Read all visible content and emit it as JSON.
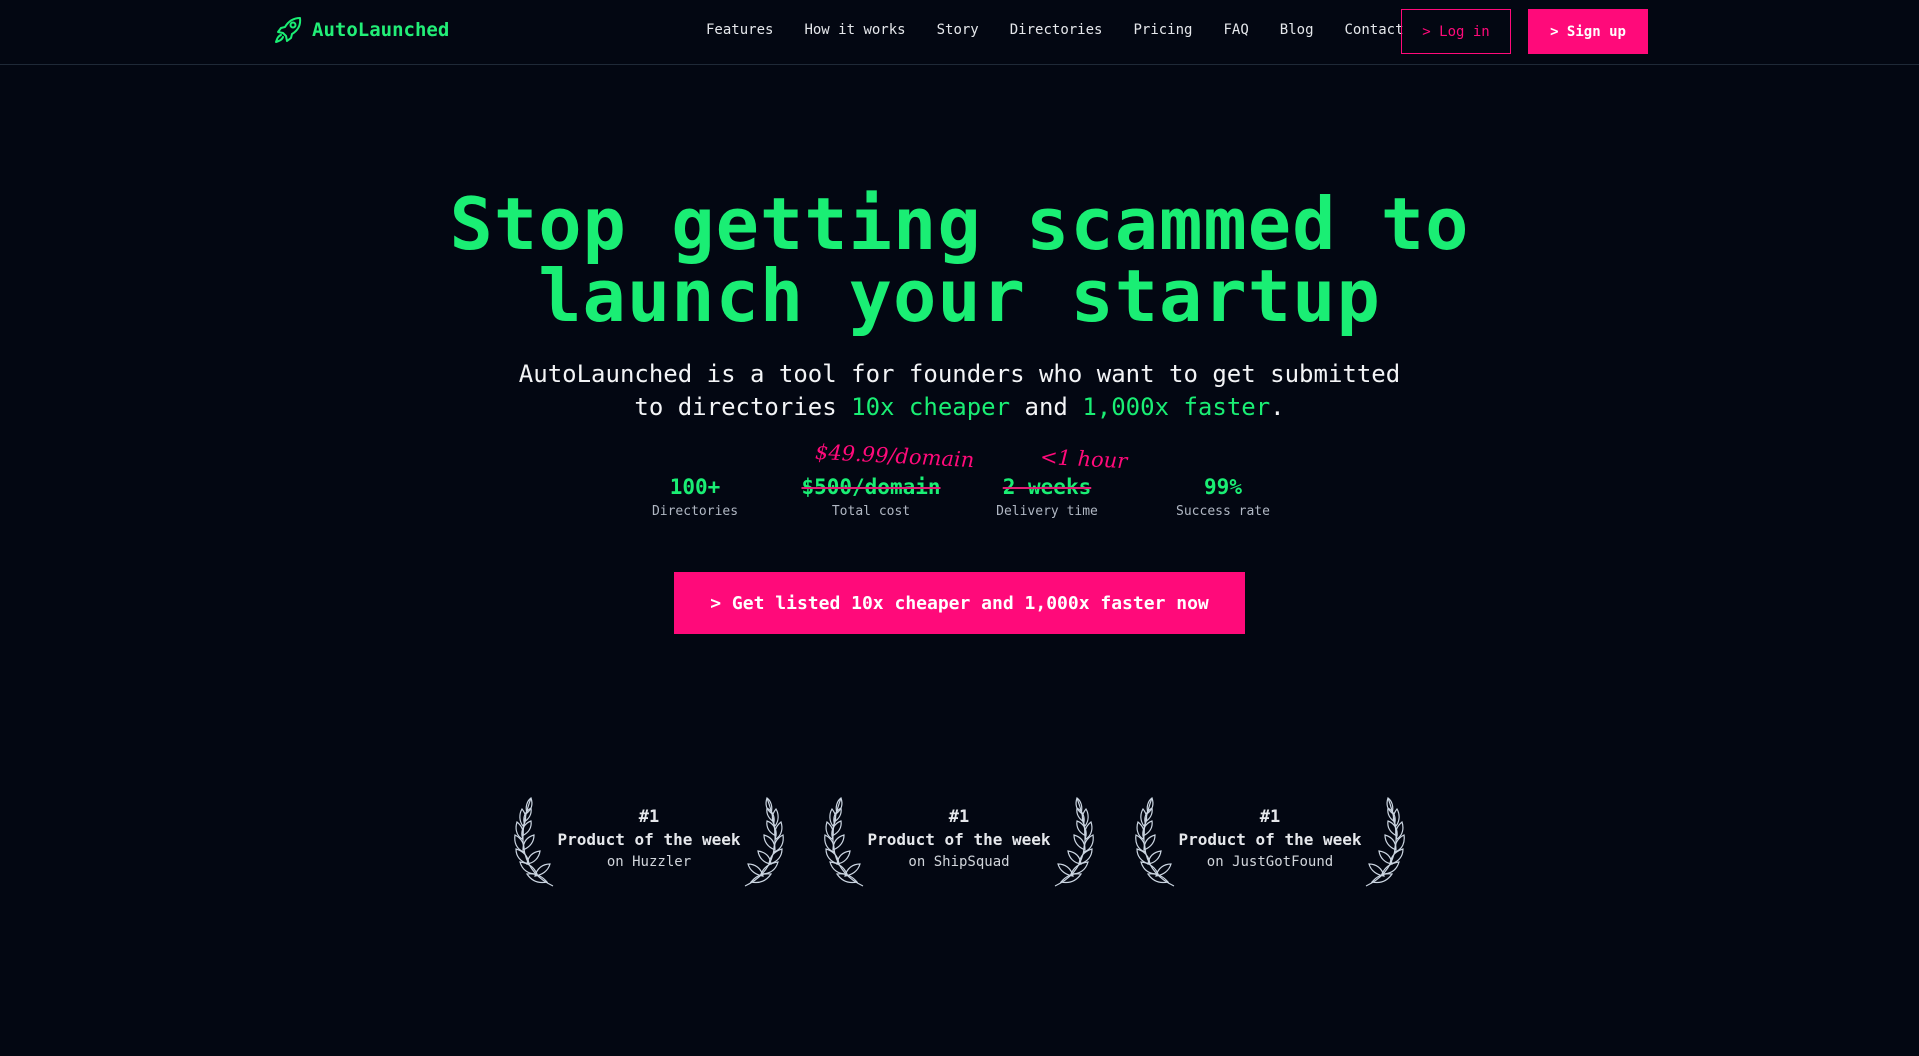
{
  "brand": {
    "name": "AutoLaunched",
    "logo_icon": "rocket-icon",
    "accent": "#1aee74"
  },
  "nav": {
    "links": [
      "Features",
      "How it works",
      "Story",
      "Directories",
      "Pricing",
      "FAQ",
      "Blog",
      "Contact"
    ],
    "login_label": "> Log in",
    "signup_label": "> Sign up"
  },
  "hero": {
    "title_line1": "Stop getting scammed to",
    "title_line2": "launch your startup",
    "subtitle_part1": "AutoLaunched is a tool for founders who want to get submitted",
    "subtitle_part2": "to directories ",
    "subtitle_hl1": "10x cheaper",
    "subtitle_and": " and ",
    "subtitle_hl2": "1,000x faster",
    "subtitle_end": "."
  },
  "stats": [
    {
      "value": "100+",
      "label": "Directories",
      "struck": false,
      "handwritten": ""
    },
    {
      "value": "$500/domain",
      "label": "Total cost",
      "struck": true,
      "handwritten": "$49.99/domain"
    },
    {
      "value": "2 weeks",
      "label": "Delivery time",
      "struck": true,
      "handwritten": "<1 hour"
    },
    {
      "value": "99%",
      "label": "Success rate",
      "struck": false,
      "handwritten": ""
    }
  ],
  "cta": {
    "label": "> Get listed 10x cheaper and 1,000x faster now"
  },
  "awards": [
    {
      "rank": "#1",
      "title": "Product of the week",
      "source": "on Huzzler"
    },
    {
      "rank": "#1",
      "title": "Product of the week",
      "source": "on ShipSquad"
    },
    {
      "rank": "#1",
      "title": "Product of the week",
      "source": "on JustGotFound"
    }
  ],
  "colors": {
    "background": "#030712",
    "pink": "#ff0a7a",
    "green": "#1aee74"
  }
}
